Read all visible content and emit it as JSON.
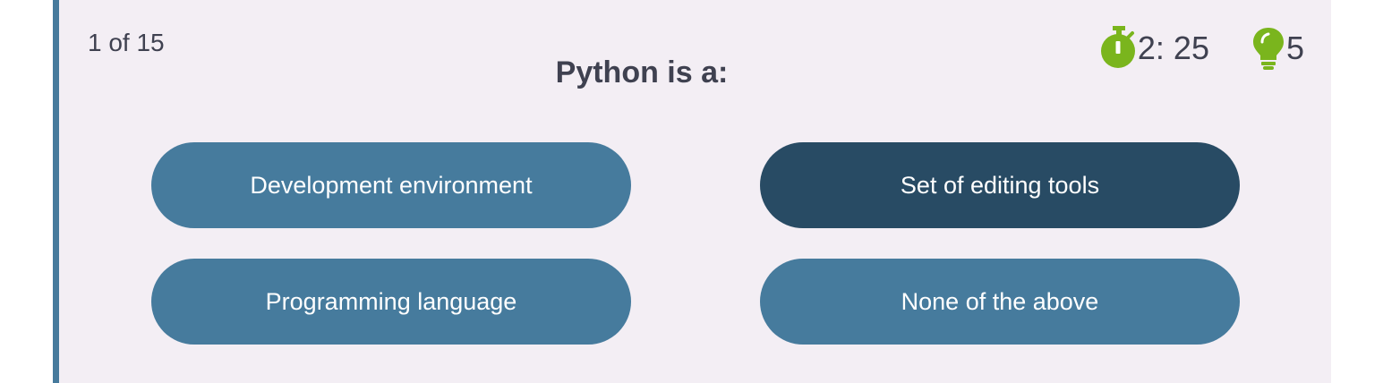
{
  "quiz": {
    "progress": "1 of 15",
    "question": "Python is a:",
    "timer": "2: 25",
    "timer_icon": "stopwatch-icon",
    "hints": "5",
    "hints_icon": "lightbulb-icon",
    "accent_color": "#7ab51d"
  },
  "options": [
    {
      "label": "Development environment",
      "selected": false
    },
    {
      "label": "Set of editing tools",
      "selected": true
    },
    {
      "label": "Programming language",
      "selected": false
    },
    {
      "label": "None of the above",
      "selected": false
    }
  ],
  "colors": {
    "card_background": "#f3eef4",
    "option_background": "#467b9d",
    "option_selected_background": "#284b64",
    "left_border": "#467a9c",
    "text": "#3f4150"
  }
}
